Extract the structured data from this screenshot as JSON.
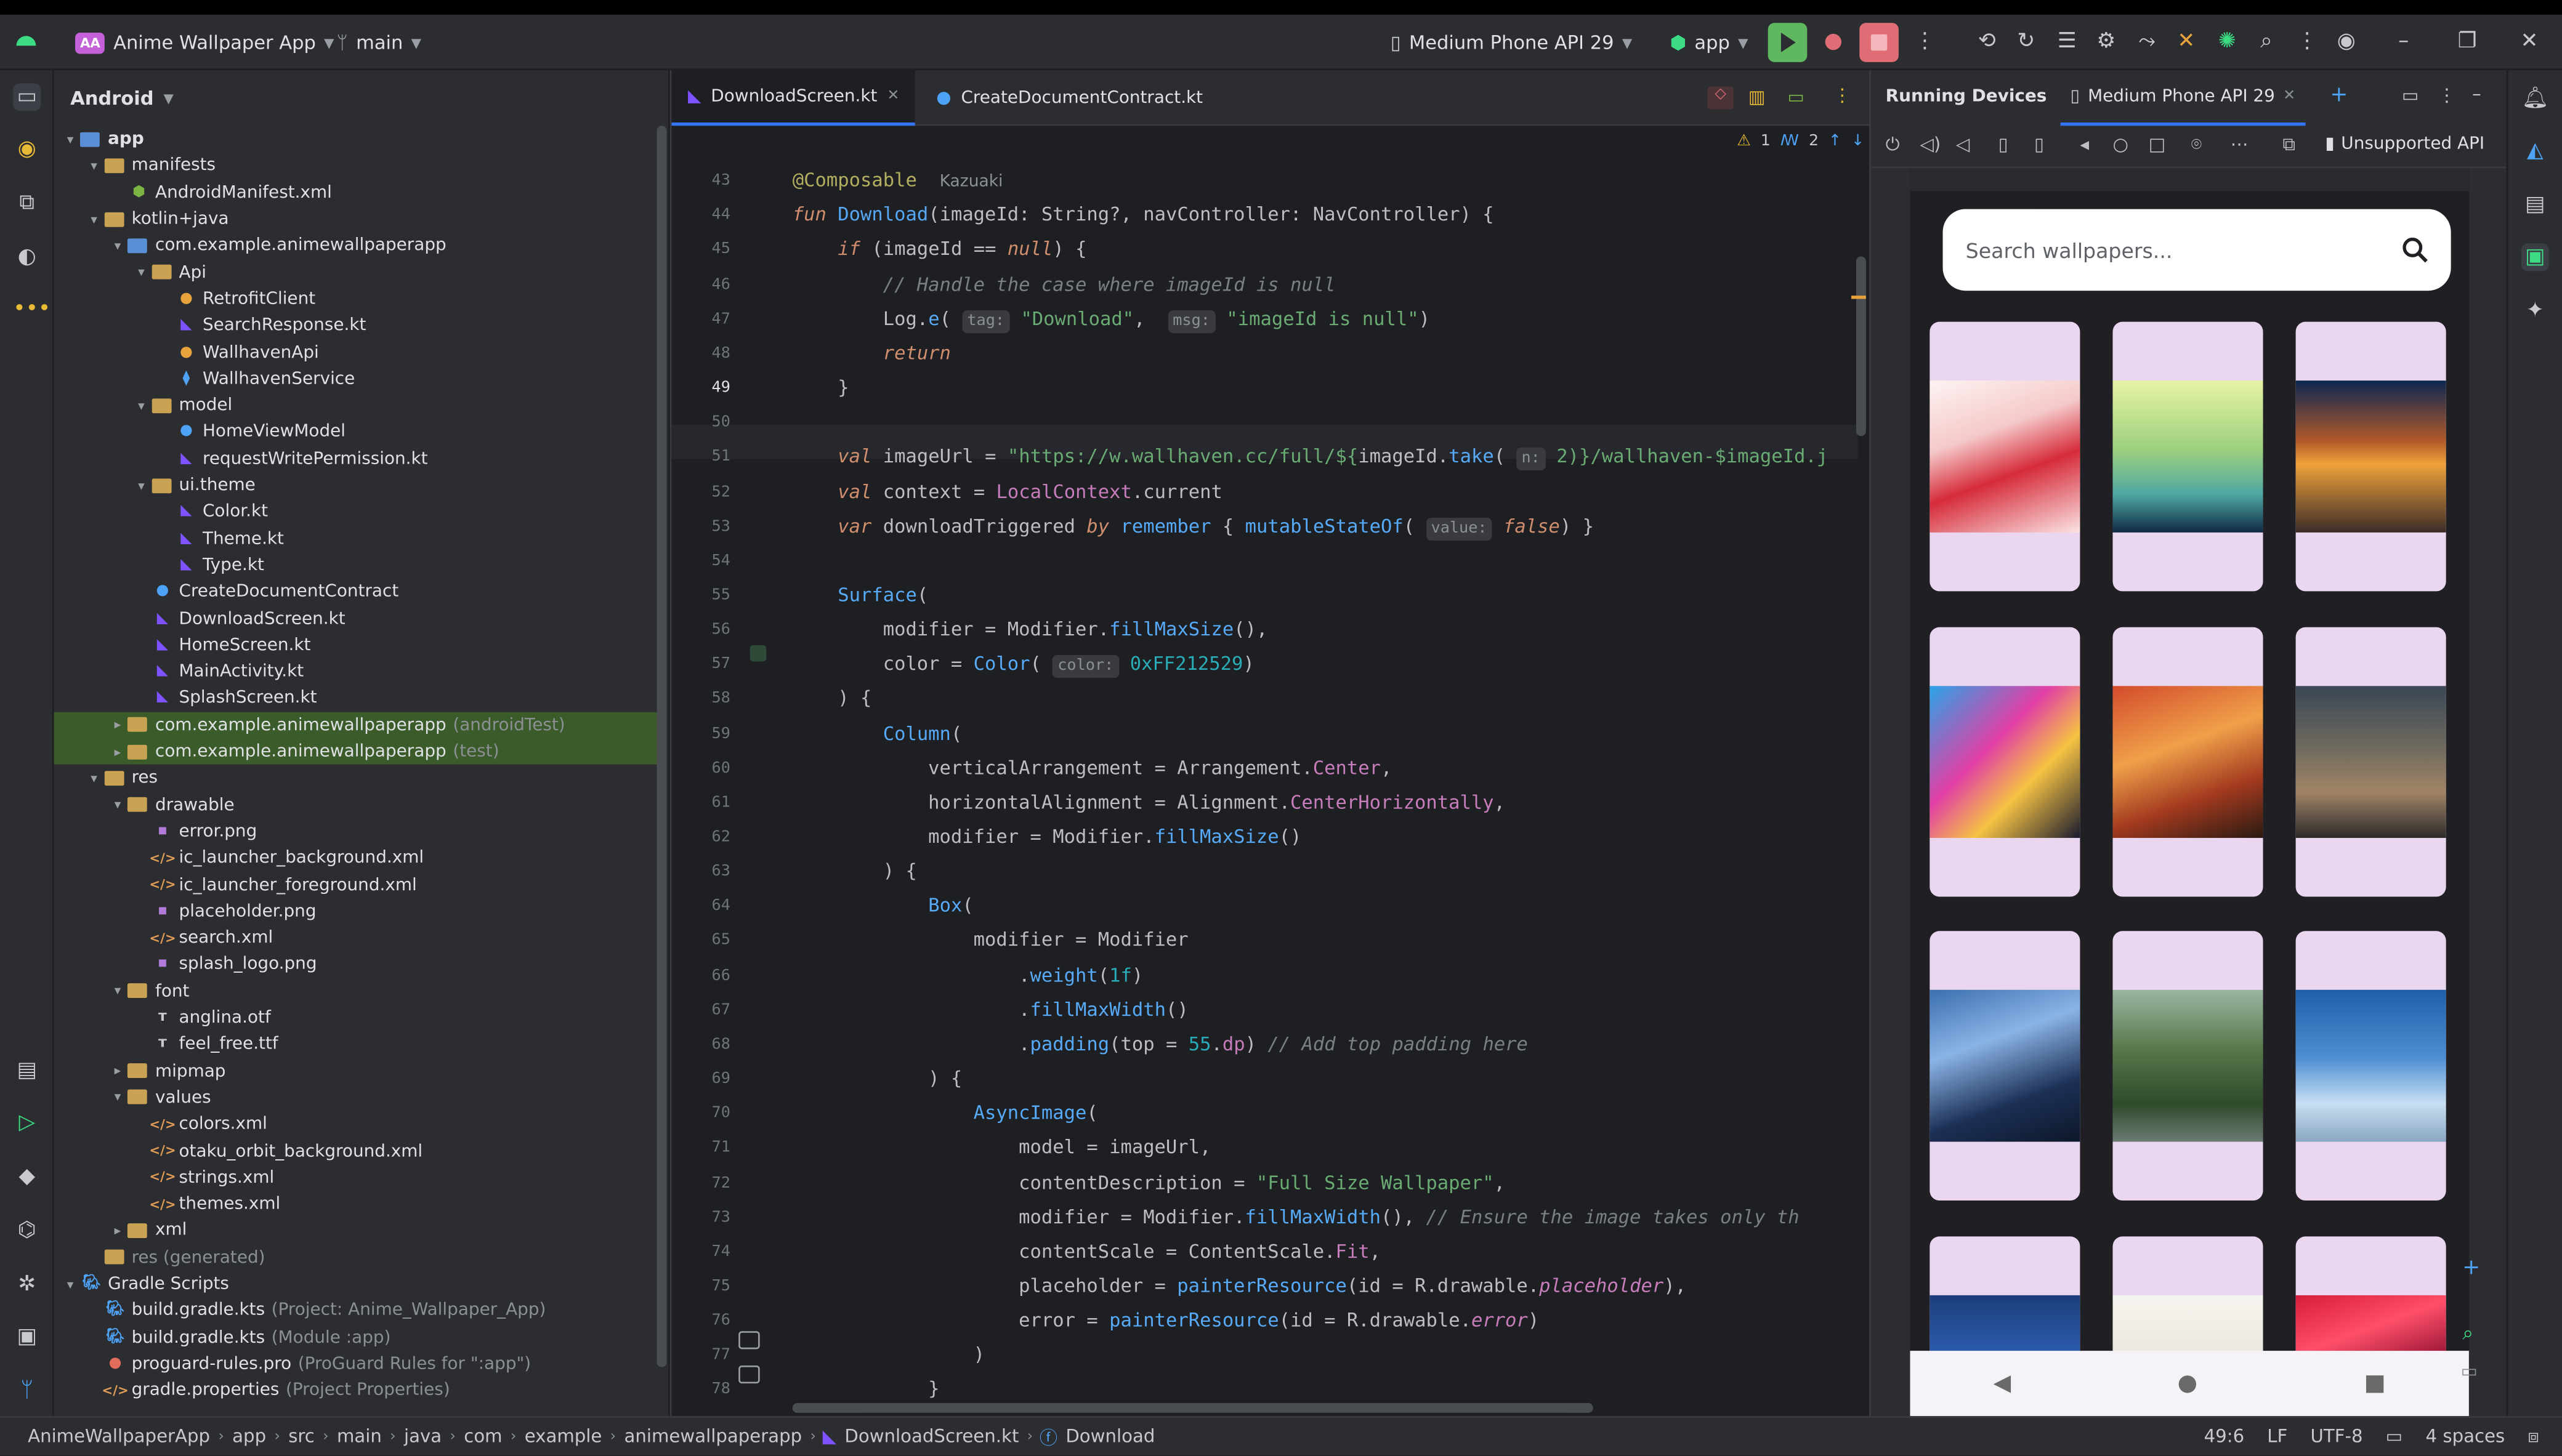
{
  "titlebar": {
    "project_badge": "AA",
    "project_name": "Anime Wallpaper App",
    "branch": "main",
    "device": "Medium Phone API 29",
    "run_config": "app"
  },
  "project_panel": {
    "view_mode": "Android",
    "tree": [
      {
        "label": "app",
        "depth": 0,
        "icon": "folder-module",
        "toggle": "▾",
        "bold": true
      },
      {
        "label": "manifests",
        "depth": 1,
        "icon": "folder",
        "toggle": "▾"
      },
      {
        "label": "AndroidManifest.xml",
        "depth": 2,
        "icon": "android-icon",
        "toggle": ""
      },
      {
        "label": "kotlin+java",
        "depth": 1,
        "icon": "folder",
        "toggle": "▾"
      },
      {
        "label": "com.example.animewallpaperapp",
        "depth": 2,
        "icon": "package",
        "toggle": "▾"
      },
      {
        "label": "Api",
        "depth": 3,
        "icon": "folder",
        "toggle": "▾"
      },
      {
        "label": "RetrofitClient",
        "depth": 4,
        "icon": "object",
        "toggle": ""
      },
      {
        "label": "SearchResponse.kt",
        "depth": 4,
        "icon": "kotlin",
        "toggle": ""
      },
      {
        "label": "WallhavenApi",
        "depth": 4,
        "icon": "object",
        "toggle": ""
      },
      {
        "label": "WallhavenService",
        "depth": 4,
        "icon": "interface",
        "toggle": ""
      },
      {
        "label": "model",
        "depth": 3,
        "icon": "folder",
        "toggle": "▾"
      },
      {
        "label": "HomeViewModel",
        "depth": 4,
        "icon": "class",
        "toggle": ""
      },
      {
        "label": "requestWritePermission.kt",
        "depth": 4,
        "icon": "kotlin",
        "toggle": ""
      },
      {
        "label": "ui.theme",
        "depth": 3,
        "icon": "folder",
        "toggle": "▾"
      },
      {
        "label": "Color.kt",
        "depth": 4,
        "icon": "kotlin",
        "toggle": ""
      },
      {
        "label": "Theme.kt",
        "depth": 4,
        "icon": "kotlin",
        "toggle": ""
      },
      {
        "label": "Type.kt",
        "depth": 4,
        "icon": "kotlin",
        "toggle": ""
      },
      {
        "label": "CreateDocumentContract",
        "depth": 3,
        "icon": "class",
        "toggle": ""
      },
      {
        "label": "DownloadScreen.kt",
        "depth": 3,
        "icon": "kotlin",
        "toggle": ""
      },
      {
        "label": "HomeScreen.kt",
        "depth": 3,
        "icon": "kotlin",
        "toggle": ""
      },
      {
        "label": "MainActivity.kt",
        "depth": 3,
        "icon": "kotlin",
        "toggle": ""
      },
      {
        "label": "SplashScreen.kt",
        "depth": 3,
        "icon": "kotlin",
        "toggle": ""
      },
      {
        "label": "com.example.animewallpaperapp",
        "suffix": "(androidTest)",
        "depth": 2,
        "icon": "folder",
        "toggle": "▸",
        "selected": true
      },
      {
        "label": "com.example.animewallpaperapp",
        "suffix": "(test)",
        "depth": 2,
        "icon": "folder",
        "toggle": "▸",
        "selected": true
      },
      {
        "label": "res",
        "depth": 1,
        "icon": "folder",
        "toggle": "▾"
      },
      {
        "label": "drawable",
        "depth": 2,
        "icon": "folder",
        "toggle": "▾"
      },
      {
        "label": "error.png",
        "depth": 3,
        "icon": "image",
        "toggle": ""
      },
      {
        "label": "ic_launcher_background.xml",
        "depth": 3,
        "icon": "xml",
        "toggle": ""
      },
      {
        "label": "ic_launcher_foreground.xml",
        "depth": 3,
        "icon": "xml",
        "toggle": ""
      },
      {
        "label": "placeholder.png",
        "depth": 3,
        "icon": "image",
        "toggle": ""
      },
      {
        "label": "search.xml",
        "depth": 3,
        "icon": "xml",
        "toggle": ""
      },
      {
        "label": "splash_logo.png",
        "depth": 3,
        "icon": "image",
        "toggle": ""
      },
      {
        "label": "font",
        "depth": 2,
        "icon": "folder",
        "toggle": "▾"
      },
      {
        "label": "anglina.otf",
        "depth": 3,
        "icon": "font",
        "toggle": ""
      },
      {
        "label": "feel_free.ttf",
        "depth": 3,
        "icon": "font",
        "toggle": ""
      },
      {
        "label": "mipmap",
        "depth": 2,
        "icon": "folder",
        "toggle": "▸"
      },
      {
        "label": "values",
        "depth": 2,
        "icon": "folder",
        "toggle": "▾"
      },
      {
        "label": "colors.xml",
        "depth": 3,
        "icon": "xml",
        "toggle": ""
      },
      {
        "label": "otaku_orbit_background.xml",
        "depth": 3,
        "icon": "xml",
        "toggle": ""
      },
      {
        "label": "strings.xml",
        "depth": 3,
        "icon": "xml",
        "toggle": ""
      },
      {
        "label": "themes.xml",
        "depth": 3,
        "icon": "xml",
        "toggle": ""
      },
      {
        "label": "xml",
        "depth": 2,
        "icon": "folder",
        "toggle": "▸"
      },
      {
        "label": "res (generated)",
        "depth": 1,
        "icon": "folder",
        "toggle": "",
        "muted": true
      },
      {
        "label": "Gradle Scripts",
        "depth": 0,
        "icon": "gradle",
        "toggle": "▾"
      },
      {
        "label": "build.gradle.kts",
        "suffix": "(Project: Anime_Wallpaper_App)",
        "depth": 1,
        "icon": "gradle",
        "toggle": ""
      },
      {
        "label": "build.gradle.kts",
        "suffix": "(Module :app)",
        "depth": 1,
        "icon": "gradle",
        "toggle": ""
      },
      {
        "label": "proguard-rules.pro",
        "suffix": "(ProGuard Rules for \":app\")",
        "depth": 1,
        "icon": "proguard",
        "toggle": ""
      },
      {
        "label": "gradle.properties",
        "suffix": "(Project Properties)",
        "depth": 1,
        "icon": "xml",
        "toggle": ""
      }
    ]
  },
  "editor": {
    "tabs": [
      {
        "label": "DownloadScreen.kt",
        "active": true
      },
      {
        "label": "CreateDocumentContract.kt",
        "active": false
      }
    ],
    "inspections": {
      "warnings": "1",
      "weak_warnings": "2"
    },
    "gutter_start": 43,
    "current_line": 49,
    "annotation_author": "Kazuaki",
    "code": [
      [],
      [
        [
          "@Composable",
          "an"
        ],
        [
          "  ",
          ""
        ],
        [
          "Kazuaki",
          "muted"
        ]
      ],
      [
        [
          "fun ",
          "kw-i"
        ],
        [
          "Download",
          "fn"
        ],
        [
          "(imageId: String?, navController: NavController) {",
          ""
        ]
      ],
      [
        [
          "    ",
          ""
        ],
        [
          "if ",
          "kw-i"
        ],
        [
          "(imageId == ",
          ""
        ],
        [
          "null",
          "kw-i"
        ],
        [
          ") {",
          ""
        ]
      ],
      [
        [
          "        // Handle the case where imageId is null",
          "c"
        ]
      ],
      [
        [
          "        Log.",
          ""
        ],
        [
          "e",
          "fnc"
        ],
        [
          "( ",
          ""
        ],
        [
          "tag:",
          "hint"
        ],
        [
          " ",
          ""
        ],
        [
          "\"Download\"",
          "s"
        ],
        [
          ",  ",
          ""
        ],
        [
          "msg:",
          "hint"
        ],
        [
          " ",
          ""
        ],
        [
          "\"imageId is null\"",
          "s"
        ],
        [
          ")",
          ""
        ]
      ],
      [
        [
          "        ",
          ""
        ],
        [
          "return",
          "kw-i"
        ]
      ],
      [
        [
          "    }",
          ""
        ]
      ],
      [],
      [
        [
          "    ",
          ""
        ],
        [
          "val ",
          "kw-i"
        ],
        [
          "imageUrl = ",
          ""
        ],
        [
          "\"https://w.wallhaven.cc/full/${",
          "s"
        ],
        [
          "imageId.",
          ""
        ],
        [
          "take",
          "fnc"
        ],
        [
          "( ",
          ""
        ],
        [
          "n:",
          "hint"
        ],
        [
          " 2)}",
          "s"
        ],
        [
          "/wallhaven-$imageId.j",
          "s"
        ]
      ],
      [
        [
          "    ",
          ""
        ],
        [
          "val ",
          "kw-i"
        ],
        [
          "context = ",
          ""
        ],
        [
          "LocalContext",
          "pr"
        ],
        [
          ".current",
          ""
        ]
      ],
      [
        [
          "    ",
          ""
        ],
        [
          "var ",
          "kw-i"
        ],
        [
          "downloadTriggered ",
          ""
        ],
        [
          "by ",
          "kw-i"
        ],
        [
          "remember ",
          "fnc"
        ],
        [
          "{ ",
          ""
        ],
        [
          "mutableStateOf",
          "fnc"
        ],
        [
          "( ",
          ""
        ],
        [
          "value:",
          "hint"
        ],
        [
          " ",
          ""
        ],
        [
          "false",
          "kw-i"
        ],
        [
          ") }",
          ""
        ]
      ],
      [],
      [
        [
          "    ",
          ""
        ],
        [
          "Surface",
          "fnc"
        ],
        [
          "(",
          ""
        ]
      ],
      [
        [
          "        modifier = Modifier.",
          ""
        ],
        [
          "fillMaxSize",
          "fnc"
        ],
        [
          "(),",
          ""
        ]
      ],
      [
        [
          "        color = ",
          ""
        ],
        [
          "Color",
          "fnc"
        ],
        [
          "( ",
          ""
        ],
        [
          "color:",
          "hint"
        ],
        [
          " ",
          ""
        ],
        [
          "0xFF212529",
          "n"
        ],
        [
          ")",
          ""
        ]
      ],
      [
        [
          "    ) {",
          ""
        ]
      ],
      [
        [
          "        ",
          ""
        ],
        [
          "Column",
          "fnc"
        ],
        [
          "(",
          ""
        ]
      ],
      [
        [
          "            verticalArrangement = Arrangement.",
          ""
        ],
        [
          "Center",
          "pr"
        ],
        [
          ",",
          ""
        ]
      ],
      [
        [
          "            horizontalAlignment = Alignment.",
          ""
        ],
        [
          "CenterHorizontally",
          "pr"
        ],
        [
          ",",
          ""
        ]
      ],
      [
        [
          "            modifier = Modifier.",
          ""
        ],
        [
          "fillMaxSize",
          "fnc"
        ],
        [
          "()",
          ""
        ]
      ],
      [
        [
          "        ) {",
          ""
        ]
      ],
      [
        [
          "            ",
          ""
        ],
        [
          "Box",
          "fnc"
        ],
        [
          "(",
          ""
        ]
      ],
      [
        [
          "                modifier = Modifier",
          ""
        ]
      ],
      [
        [
          "                    .",
          ""
        ],
        [
          "weight",
          "fnc"
        ],
        [
          "(",
          ""
        ],
        [
          "1f",
          "n"
        ],
        [
          ")",
          ""
        ]
      ],
      [
        [
          "                    .",
          ""
        ],
        [
          "fillMaxWidth",
          "fnc"
        ],
        [
          "()",
          ""
        ]
      ],
      [
        [
          "                    .",
          ""
        ],
        [
          "padding",
          "fnc"
        ],
        [
          "(top = ",
          ""
        ],
        [
          "55",
          "n"
        ],
        [
          ".",
          ""
        ],
        [
          "dp",
          "pr"
        ],
        [
          ") ",
          ""
        ],
        [
          "// Add top padding here",
          "c"
        ]
      ],
      [
        [
          "            ) {",
          ""
        ]
      ],
      [
        [
          "                ",
          ""
        ],
        [
          "AsyncImage",
          "fnc"
        ],
        [
          "(",
          ""
        ]
      ],
      [
        [
          "                    model = imageUrl,",
          ""
        ]
      ],
      [
        [
          "                    contentDescription = ",
          ""
        ],
        [
          "\"Full Size Wallpaper\"",
          "s"
        ],
        [
          ",",
          ""
        ]
      ],
      [
        [
          "                    modifier = Modifier.",
          ""
        ],
        [
          "fillMaxWidth",
          "fnc"
        ],
        [
          "(), ",
          ""
        ],
        [
          "// Ensure the image takes only th",
          "c"
        ]
      ],
      [
        [
          "                    contentScale = ContentScale.",
          ""
        ],
        [
          "Fit",
          "pr"
        ],
        [
          ",",
          ""
        ]
      ],
      [
        [
          "                    placeholder = ",
          ""
        ],
        [
          "painterResource",
          "fnc"
        ],
        [
          "(id = R.drawable.",
          ""
        ],
        [
          "placeholder",
          "dim"
        ],
        [
          "),",
          ""
        ]
      ],
      [
        [
          "                    error = ",
          ""
        ],
        [
          "painterResource",
          "fnc"
        ],
        [
          "(id = R.drawable.",
          ""
        ],
        [
          "error",
          "dim"
        ],
        [
          ")",
          ""
        ]
      ],
      [
        [
          "                )",
          ""
        ]
      ],
      [
        [
          "            }",
          ""
        ]
      ]
    ]
  },
  "running_devices": {
    "title": "Running Devices",
    "device_tab": "Medium Phone API 29",
    "unsupported": "Unsupported API",
    "search_placeholder": "Search wallpapers..."
  },
  "statusbar": {
    "breadcrumbs": [
      "AnimeWallpaperApp",
      "app",
      "src",
      "main",
      "java",
      "com",
      "example",
      "animewallpaperapp",
      "DownloadScreen.kt",
      "Download"
    ],
    "position": "49:6",
    "line_sep": "LF",
    "encoding": "UTF-8",
    "indent": "4 spaces"
  },
  "colors": {
    "accent": "#3574f0",
    "selection": "#3b5c2a",
    "run_green": "#5fb760",
    "stop_red": "#e06c75"
  }
}
